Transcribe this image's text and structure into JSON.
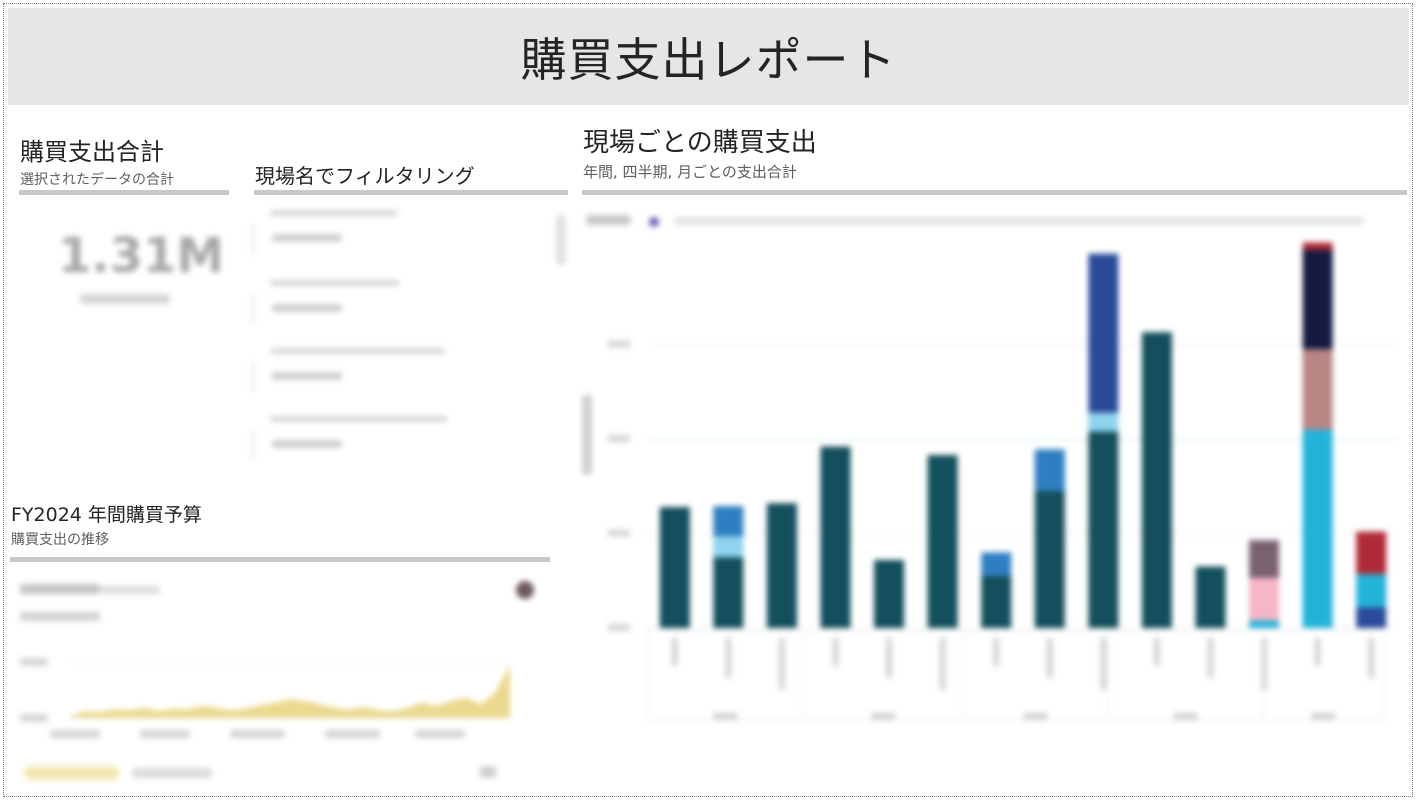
{
  "report": {
    "title": "購買支出レポート"
  },
  "kpi": {
    "title": "購買支出合計",
    "subtitle": "選択されたデータの合計",
    "value": "1.31M"
  },
  "slicer": {
    "title": "現場名でフィルタリング",
    "item_count": 4
  },
  "main_chart": {
    "title": "現場ごとの購買支出",
    "subtitle": "年間, 四半期, 月ごとの支出合計"
  },
  "budget": {
    "title": "FY2024 年間購買予算",
    "subtitle": "購買支出の推移"
  },
  "colors": {
    "teal": "#134f5c",
    "blue": "#2e7fc1",
    "navy": "#2a4a9a",
    "light_blue": "#22b3d9",
    "pale_blue": "#8fd3ef",
    "dark_navy": "#151a40",
    "mauve": "#b98585",
    "pink": "#f7b6c6",
    "red": "#b02a37",
    "purple_gray": "#7a6070",
    "gold": "#e8d27a",
    "rule": "#c8c8c8"
  },
  "chart_data": [
    {
      "type": "bar",
      "stacked": true,
      "categories": [
        "",
        "",
        "",
        "",
        "",
        "",
        "",
        "",
        "",
        "",
        "",
        "",
        "",
        ""
      ],
      "ylim": [
        0,
        400
      ],
      "grid": true,
      "series": [
        {
          "color": "#134f5c",
          "values": [
            128,
            75,
            132,
            192,
            72,
            183,
            55,
            145,
            208,
            313,
            65,
            0,
            0,
            0
          ]
        },
        {
          "color": "#8fd3ef",
          "values": [
            0,
            22,
            0,
            0,
            0,
            0,
            0,
            0,
            20,
            0,
            0,
            0,
            0,
            0
          ]
        },
        {
          "color": "#2e7fc1",
          "values": [
            0,
            32,
            0,
            0,
            0,
            0,
            25,
            44,
            0,
            0,
            0,
            0,
            0,
            0
          ]
        },
        {
          "color": "#2a4a9a",
          "values": [
            0,
            0,
            0,
            0,
            0,
            0,
            0,
            0,
            168,
            0,
            0,
            0,
            0,
            22
          ]
        },
        {
          "color": "#22b3d9",
          "values": [
            0,
            0,
            0,
            0,
            0,
            0,
            0,
            0,
            0,
            0,
            0,
            8,
            210,
            35
          ]
        },
        {
          "color": "#f7b6c6",
          "values": [
            0,
            0,
            0,
            0,
            0,
            0,
            0,
            0,
            0,
            0,
            0,
            45,
            0,
            0
          ]
        },
        {
          "color": "#7a6070",
          "values": [
            0,
            0,
            0,
            0,
            0,
            0,
            0,
            0,
            0,
            0,
            0,
            40,
            0,
            0
          ]
        },
        {
          "color": "#b98585",
          "values": [
            0,
            0,
            0,
            0,
            0,
            0,
            0,
            0,
            0,
            0,
            0,
            0,
            85,
            0
          ]
        },
        {
          "color": "#151a40",
          "values": [
            0,
            0,
            0,
            0,
            0,
            0,
            0,
            0,
            0,
            0,
            0,
            0,
            105,
            0
          ]
        },
        {
          "color": "#b02a37",
          "values": [
            0,
            0,
            0,
            0,
            0,
            0,
            0,
            0,
            0,
            0,
            0,
            0,
            8,
            45
          ]
        }
      ]
    },
    {
      "type": "area",
      "x": [
        0,
        1,
        2,
        3,
        4,
        5,
        6,
        7,
        8,
        9,
        10,
        11,
        12,
        13,
        14,
        15,
        16,
        17,
        18,
        19,
        20,
        21,
        22,
        23,
        24,
        25,
        26,
        27,
        28,
        29,
        30
      ],
      "series": [
        {
          "color": "#e8d27a",
          "values": [
            2,
            8,
            7,
            10,
            9,
            12,
            8,
            11,
            10,
            14,
            12,
            9,
            11,
            15,
            18,
            22,
            20,
            16,
            12,
            10,
            13,
            9,
            8,
            12,
            18,
            14,
            20,
            24,
            16,
            30,
            62
          ]
        }
      ]
    }
  ]
}
